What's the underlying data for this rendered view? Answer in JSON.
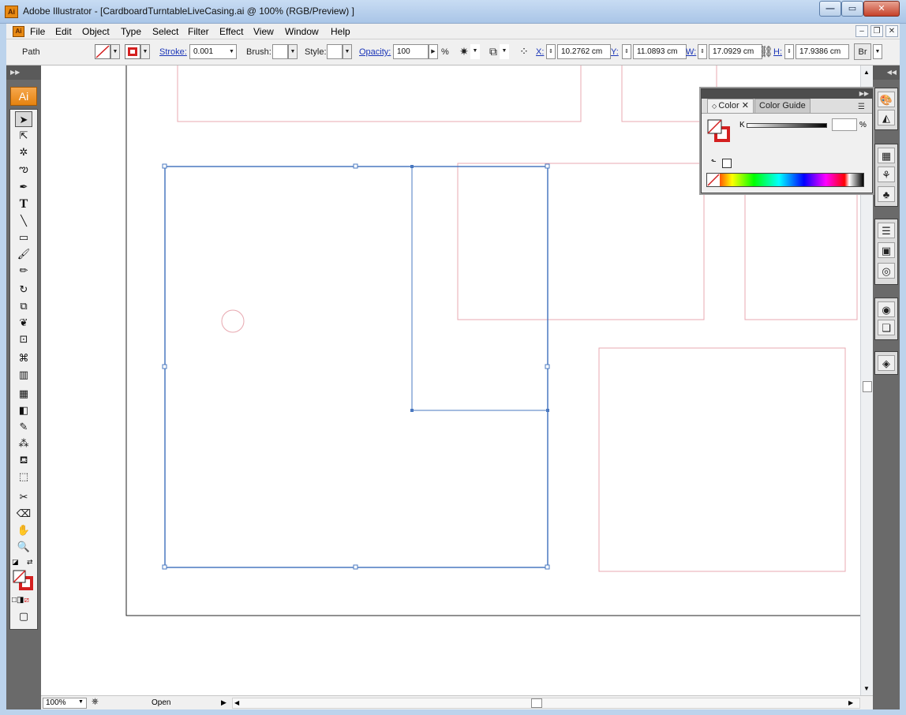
{
  "window": {
    "title": "Adobe Illustrator - [CardboardTurntableLiveCasing.ai @ 100% (RGB/Preview) ]",
    "app_icon_label": "Ai",
    "controls": [
      "minimize-icon",
      "maximize-icon",
      "close-icon"
    ]
  },
  "menu": {
    "items": [
      "File",
      "Edit",
      "Object",
      "Type",
      "Select",
      "Filter",
      "Effect",
      "View",
      "Window",
      "Help"
    ]
  },
  "control_bar": {
    "selection_label": "Path",
    "stroke_label": "Stroke:",
    "stroke_value": "0.001",
    "brush_label": "Brush:",
    "style_label": "Style:",
    "opacity_label": "Opacity:",
    "opacity_value": "100",
    "percent": "%",
    "x_label": "X:",
    "x_value": "10.2762 cm",
    "y_label": "Y:",
    "y_value": "11.0893 cm",
    "w_label": "W:",
    "w_value": "17.0929 cm",
    "h_label": "H:",
    "h_value": "17.9386 cm",
    "stroke_color": "#d42020"
  },
  "tools": {
    "logo": "Ai",
    "items": [
      "selection-tool-icon",
      "direct-selection-tool-icon",
      "magic-wand-tool-icon",
      "lasso-tool-icon",
      "pen-tool-icon",
      "type-tool-icon",
      "line-segment-tool-icon",
      "rectangle-tool-icon",
      "paintbrush-tool-icon",
      "pencil-tool-icon",
      "rotate-tool-icon",
      "scale-tool-icon",
      "warp-tool-icon",
      "free-transform-tool-icon",
      "symbol-sprayer-tool-icon",
      "column-graph-tool-icon",
      "mesh-tool-icon",
      "gradient-tool-icon",
      "eyedropper-tool-icon",
      "blend-tool-icon",
      "live-paint-bucket-tool-icon",
      "live-paint-selection-tool-icon",
      "slice-tool-icon",
      "eraser-tool-icon",
      "hand-tool-icon",
      "zoom-tool-icon"
    ]
  },
  "color_panel": {
    "tabs": [
      "Color",
      "Color Guide"
    ],
    "channel_label": "K",
    "percent": "%",
    "fill": "none",
    "stroke": "#d42020"
  },
  "status_bar": {
    "zoom": "100%",
    "status_text": "Open"
  },
  "colors": {
    "selection_blue": "#4a78c0",
    "guide_pink": "#e8a8b0",
    "artboard_edge": "#222222",
    "accent_orange": "#e88a14"
  }
}
